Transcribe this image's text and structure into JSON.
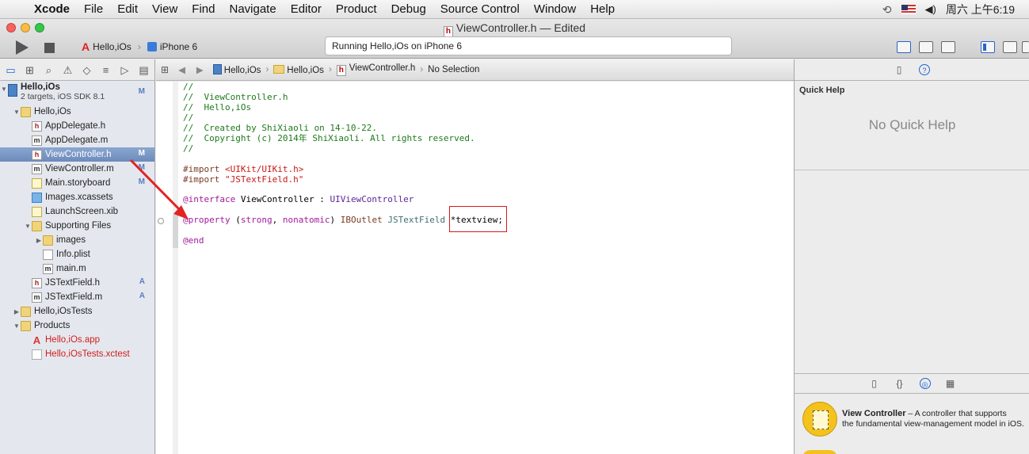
{
  "menubar": {
    "app": "Xcode",
    "items": [
      "File",
      "Edit",
      "View",
      "Find",
      "Navigate",
      "Editor",
      "Product",
      "Debug",
      "Source Control",
      "Window",
      "Help"
    ],
    "clock": "周六 上午6:19"
  },
  "window": {
    "title": "ViewController.h — Edited",
    "scheme_target": "Hello,iOs",
    "scheme_device": "iPhone 6",
    "activity_status": "Running Hello,iOs on iPhone 6"
  },
  "navigator": {
    "project": {
      "name": "Hello,iOs",
      "subtitle": "2 targets, iOS SDK 8.1",
      "badge": "M"
    },
    "rows": [
      {
        "label": "Hello,iOs",
        "kind": "folder",
        "indent": 1,
        "tri": "▼",
        "badge": ""
      },
      {
        "label": "AppDelegate.h",
        "kind": "h",
        "indent": 2,
        "tri": "",
        "badge": ""
      },
      {
        "label": "AppDelegate.m",
        "kind": "m",
        "indent": 2,
        "tri": "",
        "badge": ""
      },
      {
        "label": "ViewController.h",
        "kind": "h",
        "indent": 2,
        "tri": "",
        "badge": "M",
        "selected": true
      },
      {
        "label": "ViewController.m",
        "kind": "m",
        "indent": 2,
        "tri": "",
        "badge": "M"
      },
      {
        "label": "Main.storyboard",
        "kind": "xib",
        "indent": 2,
        "tri": "",
        "badge": "M"
      },
      {
        "label": "Images.xcassets",
        "kind": "assets",
        "indent": 2,
        "tri": "",
        "badge": ""
      },
      {
        "label": "LaunchScreen.xib",
        "kind": "xib",
        "indent": 2,
        "tri": "",
        "badge": ""
      },
      {
        "label": "Supporting Files",
        "kind": "folder",
        "indent": 2,
        "tri": "▼",
        "badge": ""
      },
      {
        "label": "images",
        "kind": "folder",
        "indent": 3,
        "tri": "▶",
        "badge": ""
      },
      {
        "label": "Info.plist",
        "kind": "plist",
        "indent": 3,
        "tri": "",
        "badge": ""
      },
      {
        "label": "main.m",
        "kind": "m",
        "indent": 3,
        "tri": "",
        "badge": ""
      },
      {
        "label": "JSTextField.h",
        "kind": "h",
        "indent": 2,
        "tri": "",
        "badge": "A"
      },
      {
        "label": "JSTextField.m",
        "kind": "m",
        "indent": 2,
        "tri": "",
        "badge": "A"
      },
      {
        "label": "Hello,iOsTests",
        "kind": "folder",
        "indent": 1,
        "tri": "▶",
        "badge": ""
      },
      {
        "label": "Products",
        "kind": "folder",
        "indent": 1,
        "tri": "▼",
        "badge": ""
      },
      {
        "label": "Hello,iOs.app",
        "kind": "app",
        "indent": 2,
        "tri": "",
        "badge": "",
        "red": true
      },
      {
        "label": "Hello,iOsTests.xctest",
        "kind": "xctest",
        "indent": 2,
        "tri": "",
        "badge": "",
        "red": true
      }
    ]
  },
  "jumpbar": {
    "crumbs": [
      "Hello,iOs",
      "Hello,iOs",
      "ViewController.h",
      "No Selection"
    ]
  },
  "editor": {
    "comment_lines": [
      "//",
      "//  ViewController.h",
      "//  Hello,iOs",
      "//",
      "//  Created by ShiXiaoli on 14-10-22.",
      "//  Copyright (c) 2014年 ShiXiaoli. All rights reserved.",
      "//"
    ],
    "import1_kw": "#import ",
    "import1_path": "<UIKit/UIKit.h>",
    "import2_kw": "#import ",
    "import2_path": "\"JSTextField.h\"",
    "interface_kw": "@interface",
    "interface_name": " ViewController : ",
    "interface_super": "UIViewController",
    "property_kw": "@property",
    "property_open": " (",
    "property_attr1": "strong",
    "property_comma": ", ",
    "property_attr2": "nonatomic",
    "property_close": ") ",
    "property_outlet": "IBOutlet",
    "property_type": " JSTextField ",
    "property_var": "*textview;",
    "end_kw": "@end"
  },
  "inspector": {
    "quick_help_title": "Quick Help",
    "quick_help_empty": "No Quick Help",
    "library_item_name": "View Controller",
    "library_item_desc_1": " – A controller that supports",
    "library_item_desc_2": "the fundamental view-management model in iOS."
  },
  "colors": {
    "selection": "#7593c2",
    "annotation_red": "#d9191a",
    "comment": "#1c7a1c",
    "keyword": "#a21a9a"
  }
}
